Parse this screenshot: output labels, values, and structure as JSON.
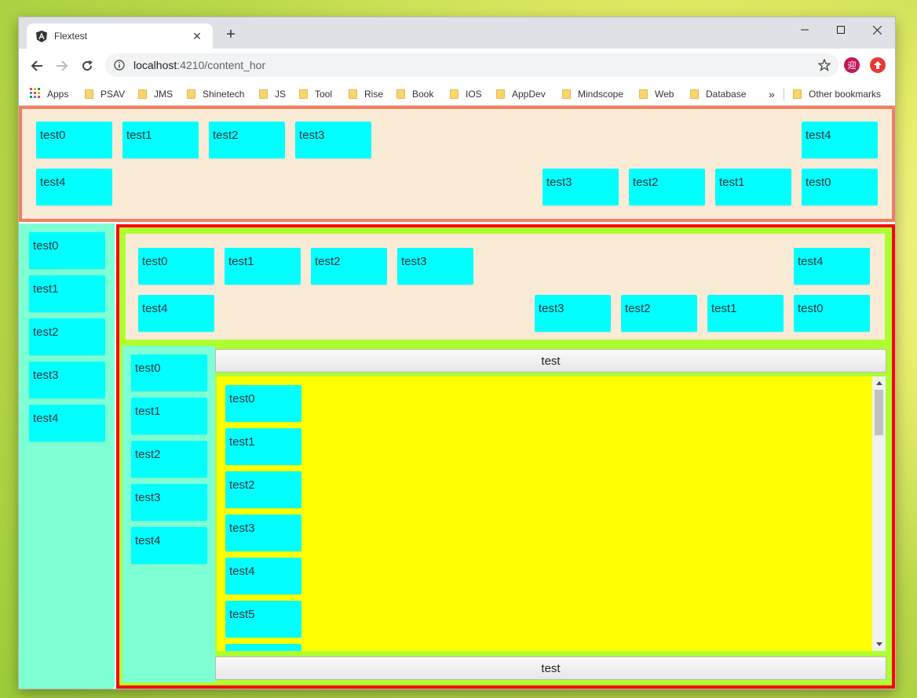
{
  "browser": {
    "tab_title": "Flextest",
    "url_host": "localhost",
    "url_rest": ":4210/content_hor",
    "extension_avatar": "迎",
    "bookmarks": [
      "Apps",
      "PSAV",
      "JMS",
      "Shinetech",
      "JS",
      "Tool",
      "Rise",
      "Book",
      "IOS",
      "AppDev",
      "Mindscope",
      "Web",
      "Database"
    ],
    "other_bookmarks": "Other bookmarks",
    "overflow": "»"
  },
  "top_section": {
    "row1_left": [
      "test0",
      "test1",
      "test2",
      "test3"
    ],
    "row1_right": "test4",
    "row2_left": "test4",
    "row2_right": [
      "test3",
      "test2",
      "test1",
      "test0"
    ]
  },
  "left_sidebar": {
    "items": [
      "test0",
      "test1",
      "test2",
      "test3",
      "test4"
    ]
  },
  "inner_top_section": {
    "row1_left": [
      "test0",
      "test1",
      "test2",
      "test3"
    ],
    "row1_right": "test4",
    "row2_left": "test4",
    "row2_right": [
      "test3",
      "test2",
      "test1",
      "test0"
    ]
  },
  "inner_sidebar": {
    "items": [
      "test0",
      "test1",
      "test2",
      "test3",
      "test4"
    ]
  },
  "content": {
    "top_button": "test",
    "bottom_button": "test",
    "list_items": [
      "test0",
      "test1",
      "test2",
      "test3",
      "test4",
      "test5"
    ]
  },
  "colors": {
    "item": "#00ffff",
    "section_bg": "#faebd7",
    "sidebar_bg": "#7fffd4",
    "outer_border": "#ff0000",
    "inner_border": "#adff2f",
    "content_bg": "#ffff00",
    "top_border": "#f08060"
  }
}
